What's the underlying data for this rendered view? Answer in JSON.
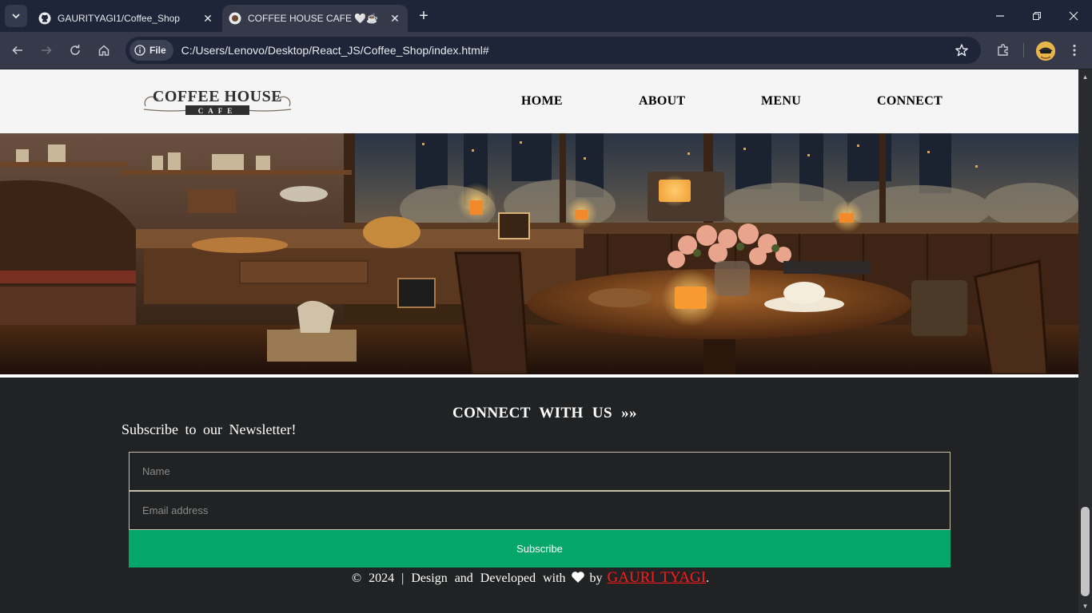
{
  "browser": {
    "tabs": [
      {
        "title": "GAURITYAGI1/Coffee_Shop",
        "favicon": "github-icon",
        "active": false
      },
      {
        "title": "COFFEE HOUSE CAFE 🤍☕",
        "favicon": "coffee-icon",
        "active": true
      }
    ],
    "address_chip": "File",
    "url": "C:/Users/Lenovo/Desktop/React_JS/Coffee_Shop/index.html#"
  },
  "site": {
    "logo": {
      "main": "COFFEE HOUSE",
      "sub": "CAFE"
    },
    "nav": [
      "HOME",
      "ABOUT",
      "MENU",
      "CONNECT"
    ]
  },
  "connect": {
    "heading": "CONNECT WITH US »»",
    "newsletter_label": "Subscribe to our Newsletter!",
    "name_placeholder": "Name",
    "email_placeholder": "Email address",
    "subscribe_label": "Subscribe"
  },
  "footer": {
    "prefix": "© 2024 | Design and Developed with",
    "by": "by",
    "author": "GAURI TYAGI",
    "suffix": "."
  },
  "colors": {
    "tab_strip": "#1f2538",
    "toolbar": "#35394a",
    "page_bg": "#212223",
    "header_bg": "#f5f5f5",
    "subscribe_button": "#04a66a",
    "author_link": "#ff1a1a"
  }
}
